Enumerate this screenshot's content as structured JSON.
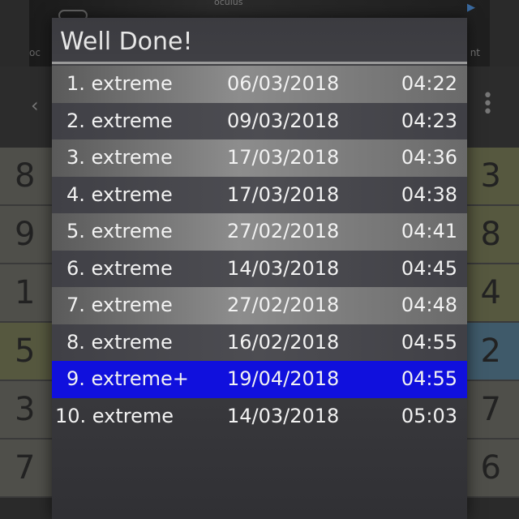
{
  "ad": {
    "brand": "oculus",
    "left_fragment": "oc",
    "right_fragment": "nt"
  },
  "background": {
    "left_numbers": [
      "8",
      "9",
      "1",
      "5",
      "3",
      "7"
    ],
    "right_numbers": [
      "3",
      "8",
      "4",
      "2",
      "7",
      "6"
    ]
  },
  "dialog": {
    "title": "Well Done!",
    "rows": [
      {
        "name": "1. extreme",
        "date": "06/03/2018",
        "time": "04:22"
      },
      {
        "name": "2. extreme",
        "date": "09/03/2018",
        "time": "04:23"
      },
      {
        "name": "3. extreme",
        "date": "17/03/2018",
        "time": "04:36"
      },
      {
        "name": "4. extreme",
        "date": "17/03/2018",
        "time": "04:38"
      },
      {
        "name": "5. extreme",
        "date": "27/02/2018",
        "time": "04:41"
      },
      {
        "name": "6. extreme",
        "date": "14/03/2018",
        "time": "04:45"
      },
      {
        "name": "7. extreme",
        "date": "27/02/2018",
        "time": "04:48"
      },
      {
        "name": "8. extreme",
        "date": "16/02/2018",
        "time": "04:55"
      },
      {
        "name": "9. extreme+",
        "date": "19/04/2018",
        "time": "04:55"
      },
      {
        "name": "10. extreme",
        "date": "14/03/2018",
        "time": "05:03"
      }
    ],
    "highlight_color": "#1010dd"
  }
}
